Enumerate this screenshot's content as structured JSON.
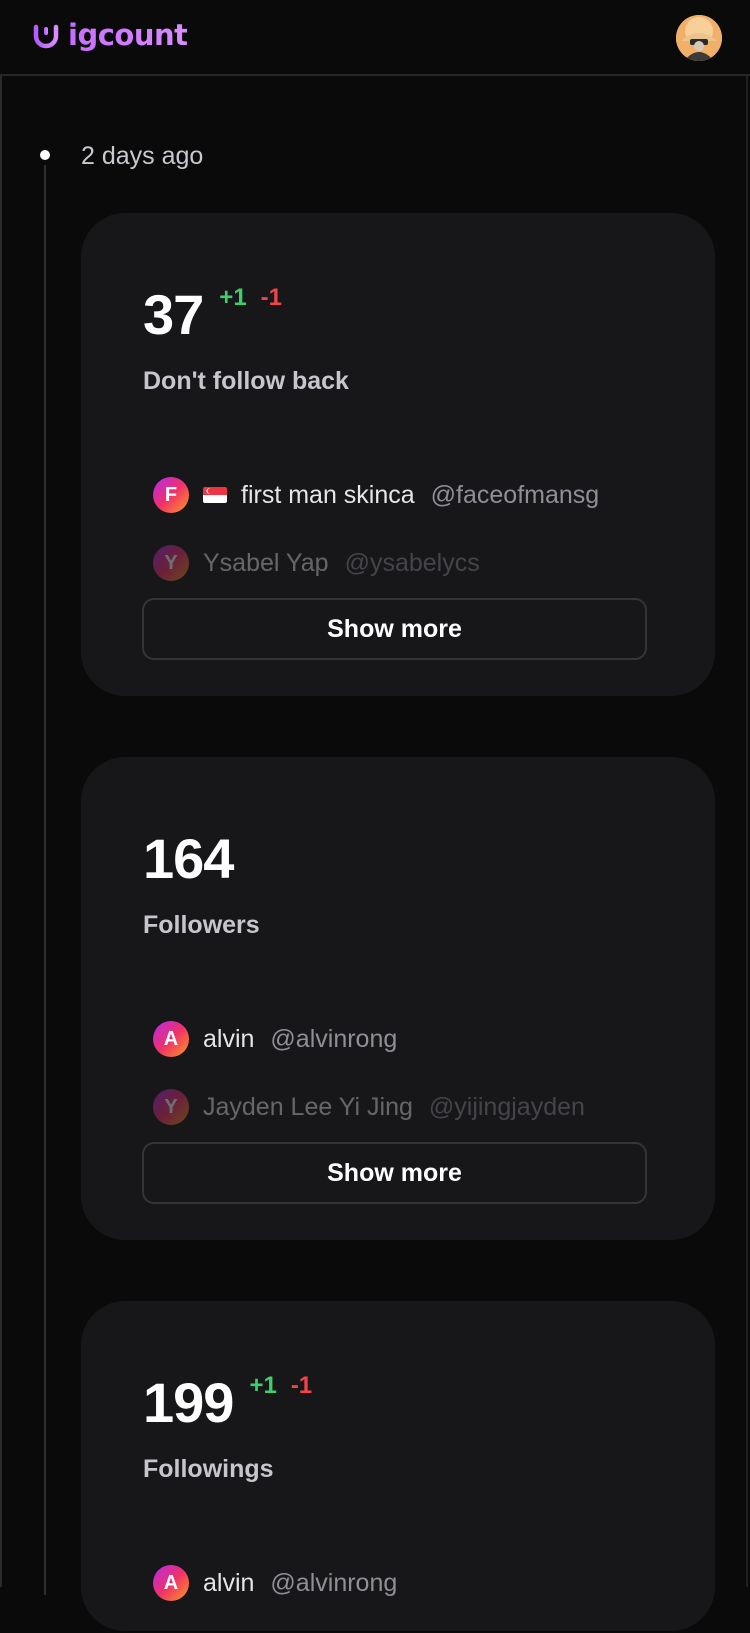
{
  "header": {
    "logo_text": "igcount"
  },
  "timeline": {
    "time_label": "2 days ago"
  },
  "cards": [
    {
      "count": "37",
      "delta_plus": "+1",
      "delta_minus": "-1",
      "label": "Don't follow back",
      "items": [
        {
          "initial": "F",
          "name": "first man skinca",
          "handle": "@faceofmansg",
          "flag": "Singapore flag"
        },
        {
          "initial": "Y",
          "name": "Ysabel Yap",
          "handle": "@ysabelycs"
        }
      ],
      "button": "Show more"
    },
    {
      "count": "164",
      "label": "Followers",
      "items": [
        {
          "initial": "A",
          "name": "alvin",
          "handle": "@alvinrong"
        },
        {
          "initial": "Y",
          "name": "Jayden Lee Yi Jing",
          "handle": "@yijingjayden"
        }
      ],
      "button": "Show more"
    },
    {
      "count": "199",
      "delta_plus": "+1",
      "delta_minus": "-1",
      "label": "Followings",
      "items": [
        {
          "initial": "A",
          "name": "alvin",
          "handle": "@alvinrong"
        }
      ]
    }
  ],
  "colors": {
    "background": "#0a0a0b",
    "card": "#17171a",
    "brand": "#c86dff",
    "positive": "#3ccf6b",
    "negative": "#f0444a"
  },
  "icons": {
    "logo": "smile-cup-logo-icon",
    "profile": "user-avatar"
  }
}
